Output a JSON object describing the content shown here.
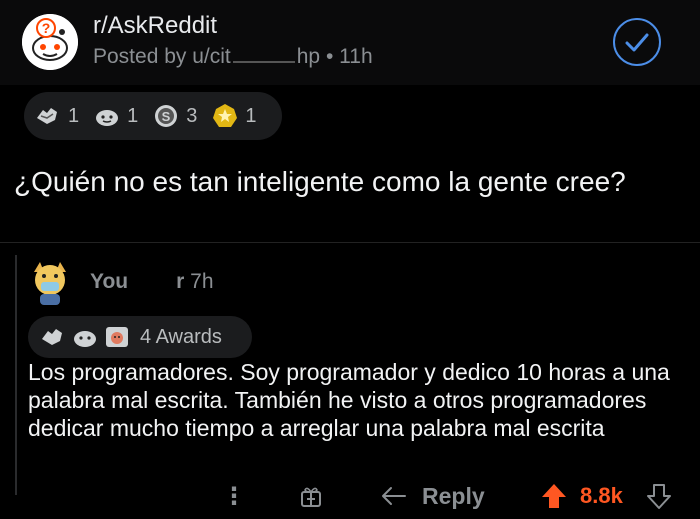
{
  "post": {
    "subreddit": "r/AskReddit",
    "posted_by_prefix": "Posted by u/cit",
    "posted_by_suffix": "hp",
    "separator": "•",
    "age": "11h",
    "awards": [
      {
        "icon": "hands-award-icon",
        "count": "1"
      },
      {
        "icon": "wholesome-award-icon",
        "count": "1"
      },
      {
        "icon": "silver-award-icon",
        "count": "3"
      },
      {
        "icon": "gold-award-icon",
        "count": "1"
      }
    ],
    "title": "¿Quién no es tan inteligente como la gente cree?"
  },
  "comment": {
    "user_prefix": "You",
    "user_suffix": "r",
    "age": "7h",
    "awards_label": "4 Awards",
    "body": "Los programadores. Soy programador y dedico 10 horas a una palabra mal escrita. También he visto a otros programadores dedicar mucho tiempo a arreglar una palabra mal escrita",
    "actions": {
      "more": "⋮",
      "reply": "Reply",
      "score": "8.8k"
    }
  },
  "colors": {
    "accent_blue": "#4c8ee8",
    "upvote_orange": "#ff5722",
    "background": "#000000"
  }
}
